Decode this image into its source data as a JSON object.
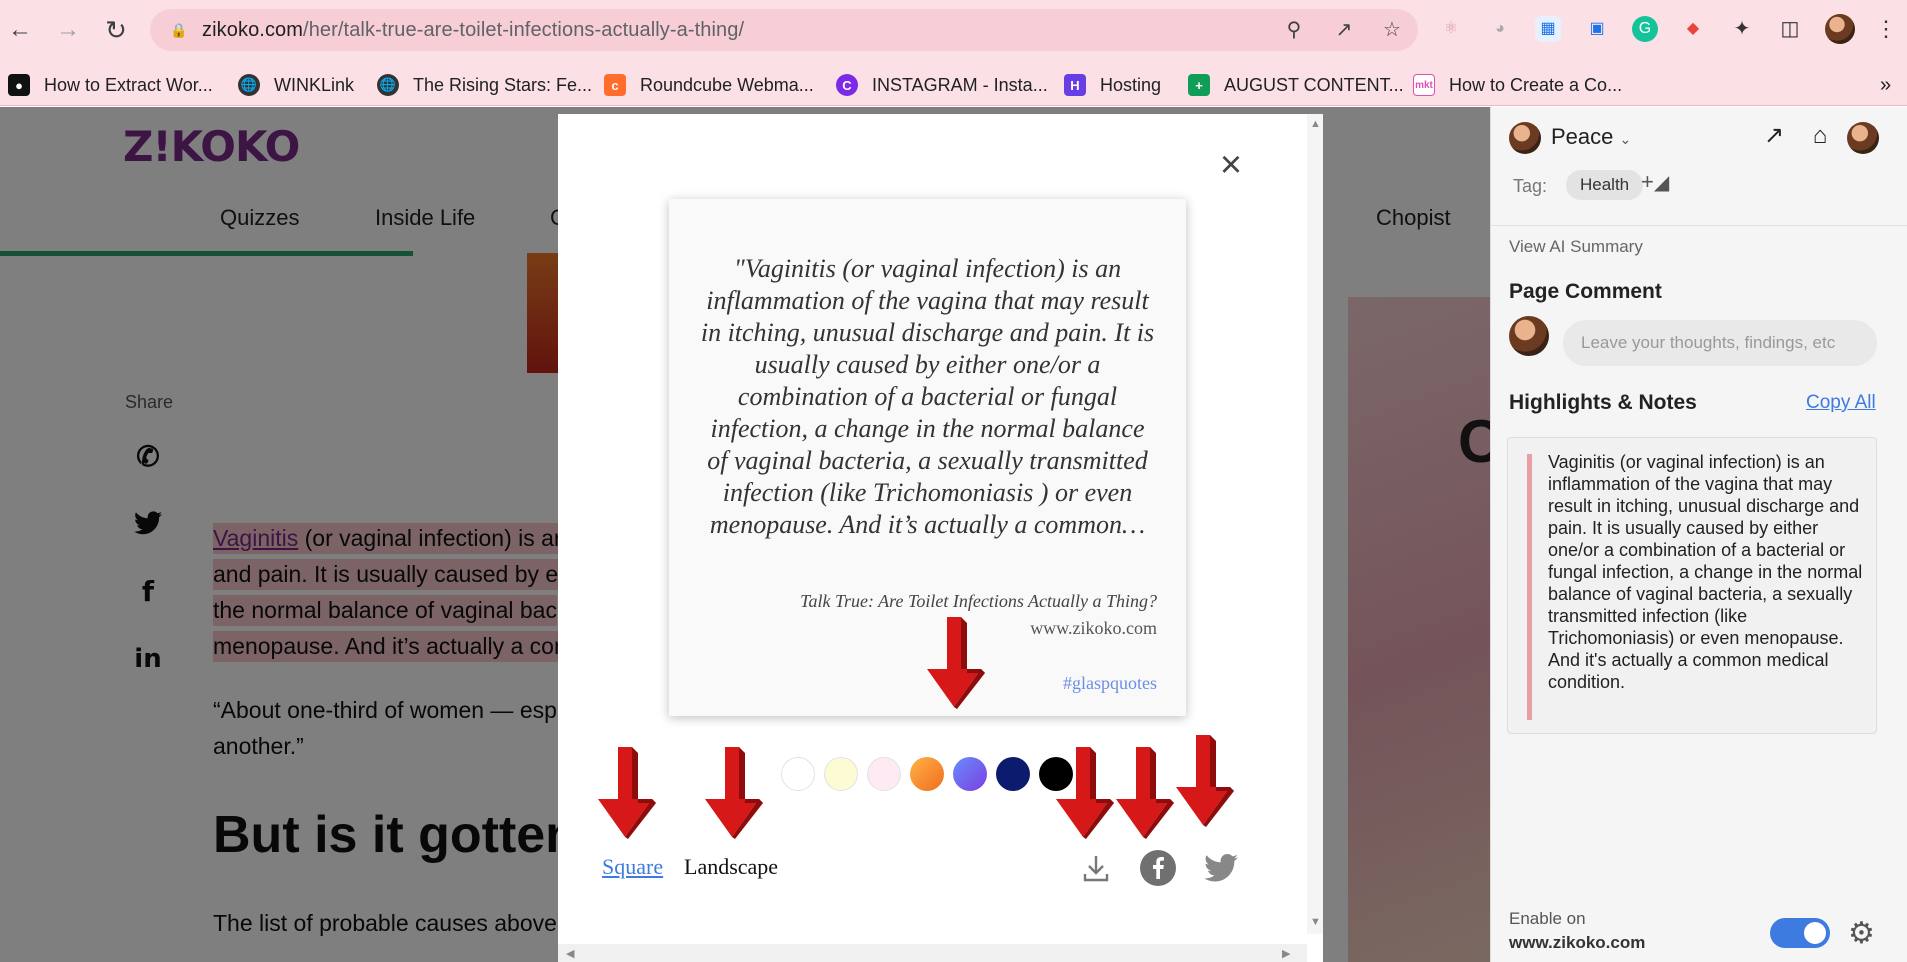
{
  "browser": {
    "url_domain": "zikoko.com",
    "url_path": "/her/talk-true-are-toilet-infections-actually-a-thing/",
    "bookmarks": [
      {
        "label": "How to Extract Wor...",
        "icon": "medium-icon",
        "color": "#111111"
      },
      {
        "label": "WINKLink",
        "icon": "globe-icon",
        "color": "#333333"
      },
      {
        "label": "The Rising Stars: Fe...",
        "icon": "globe-icon",
        "color": "#333333"
      },
      {
        "label": "Roundcube Webma...",
        "icon": "cpanel-icon",
        "color": "#ff6c2c"
      },
      {
        "label": "INSTAGRAM - Insta...",
        "icon": "canva-icon",
        "color": "#7d2ae8"
      },
      {
        "label": "Hosting",
        "icon": "hostinger-icon",
        "color": "#673de6"
      },
      {
        "label": "AUGUST CONTENT...",
        "icon": "sheets-icon",
        "color": "#0f9d58"
      },
      {
        "label": "How to Create a Co...",
        "icon": "mkt-icon",
        "color": "#e24db0"
      }
    ],
    "more": "»"
  },
  "site": {
    "logo": "Z!KOKO",
    "menu": [
      "Quizzes",
      "Inside Life",
      "C",
      "Chopist"
    ],
    "share_label": "Share",
    "highlighted_lines": [
      {
        "link": "Vaginitis",
        "rest": " (or vaginal infection) is ar"
      },
      {
        "link": "",
        "rest": "and pain. It is usually caused by ei"
      },
      {
        "link": "",
        "rest": "the normal balance of vaginal bac"
      },
      {
        "link": "",
        "rest": "menopause. And it’s actually a cor"
      }
    ],
    "body_quote": "“About one-third of women — esp another.”",
    "heading": "But is it gotten",
    "body_list": "The list of probable causes above"
  },
  "modal": {
    "quote": "\"Vaginitis (or vaginal infection) is an inflammation of the vagina that may result in itching, unusual discharge and pain. It is usually caused by either one/or a combination of a bacterial or fungal infection, a change in the normal balance of vaginal bacteria, a sexually transmitted infection (like Trichomoniasis ) or even menopause. And it’s actually a common…",
    "article_title": "Talk True: Are Toilet Infections Actually a Thing?",
    "site": "www.zikoko.com",
    "hashtag": "#glaspquotes",
    "swatches": [
      "#ffffff",
      "#fdfbd4",
      "#fdeaf2",
      "orange-gradient",
      "blue-gradient",
      "#0d1b6e",
      "#000000"
    ],
    "format_square": "Square",
    "format_landscape": "Landscape",
    "actions": [
      "download-icon",
      "facebook-icon",
      "twitter-icon"
    ]
  },
  "panel": {
    "user_name": "Peace",
    "tag_label": "Tag:",
    "tag": "Health",
    "tag_add": "+",
    "ai_summary": "View AI Summary",
    "page_comment": "Page Comment",
    "comment_placeholder": "Leave your thoughts, findings, etc",
    "highlights_title": "Highlights & Notes",
    "copy_all": "Copy All",
    "note": "Vaginitis (or vaginal infection) is an inflammation of the vagina that may result in itching, unusual discharge and pain. It is usually caused by either one/or a combination of a bacterial or fungal infection, a change in the normal balance of vaginal bacteria, a sexually transmitted infection (like Trichomoniasis) or even menopause. And it's actually a common medical condition.",
    "enable_label": "Enable on",
    "enable_site": "www.zikoko.com",
    "enabled": true
  }
}
